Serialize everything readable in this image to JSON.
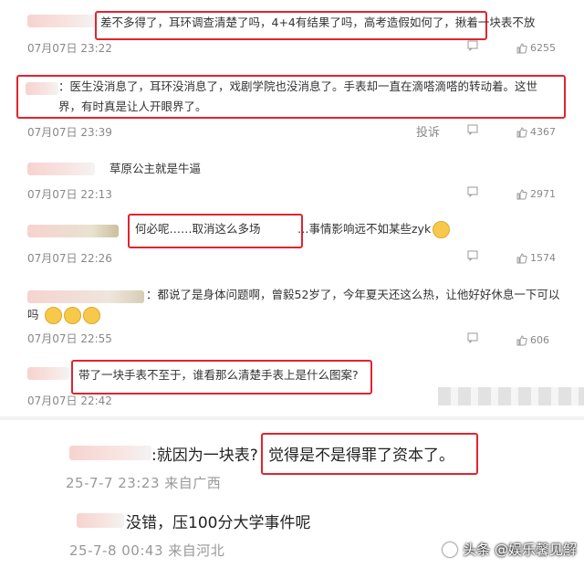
{
  "comments": [
    {
      "text": "差不多得了，耳环调查清楚了吗，4+4有结果了吗，高考造假如何了，揪着一块表不放",
      "date": "07月07日 23:22",
      "likes": "6255"
    },
    {
      "text": "：医生没消息了，耳环没消息了，戏剧学院也没消息了。手表却一直在滴嗒滴嗒的转动着。这世界，有时真是让人开眼界了。",
      "date": "07月07日 23:39",
      "report": "投诉",
      "likes": "4367"
    },
    {
      "text": "草原公主就是牛逼",
      "date": "07月07日 22:13",
      "likes": "2971"
    },
    {
      "text_boxed": "何必呢……取消这么多场",
      "text_rest": "…事情影响远不如某些zyk",
      "date": "07月07日 22:26",
      "likes": "1574"
    },
    {
      "text": "：都说了是身体问题啊，曾毅52岁了，今年夏天还这么热，让他好好休息一下可以吗",
      "date": "07月07日 22:55",
      "likes": "606"
    },
    {
      "text": "带了一块手表不至于，谁看那么清楚手表上是什么图案?",
      "date": "07月07日 22:42"
    }
  ],
  "bottom_comments": [
    {
      "text_prefix": ":就因为一块表?",
      "text_boxed": "觉得是不是得罪了资本了。",
      "meta": "25-7-7 23:23 来自广西"
    },
    {
      "text": "没错，压100分大学事件呢",
      "meta": "25-7-8 00:43 来自河北"
    }
  ],
  "watermark": "头条 @娱乐馨见解",
  "colors": {
    "highlight": "#e0242f"
  }
}
